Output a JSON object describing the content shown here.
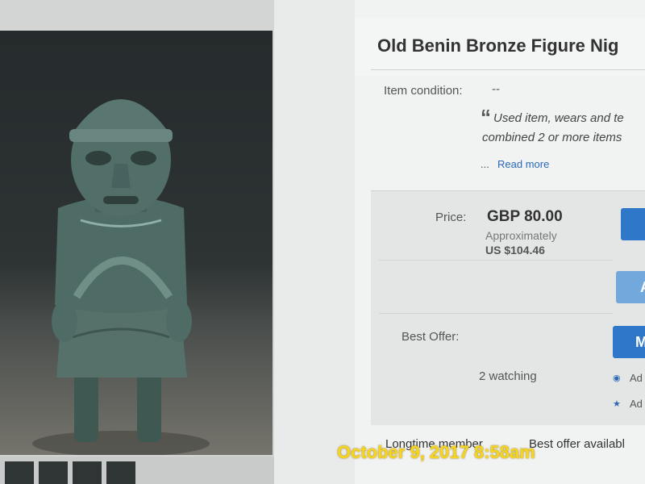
{
  "listing": {
    "title": "Old Benin Bronze Figure Nig",
    "condition_label": "Item condition:",
    "condition_value": "--",
    "description_line1": "Used item, wears and te",
    "description_line2": "combined 2 or more items",
    "ellipsis": "...",
    "read_more": "Read more"
  },
  "pricing": {
    "price_label": "Price:",
    "price": "GBP 80.00",
    "approx_label": "Approximately",
    "usd_price": "US $104.46",
    "buy_button_label": "",
    "add_button_label": "A",
    "best_offer_label": "Best Offer:",
    "offer_button_label": "M",
    "watching": "2 watching",
    "watch_link": "Ad",
    "collection_link": "Ad"
  },
  "footer": {
    "seller_note": "Longtime member",
    "best_offer_note": "Best offer availabl"
  },
  "overlay": {
    "timestamp": "October 9, 2017 8:58am"
  },
  "colors": {
    "accent": "#2f77c8",
    "link": "#2a6ab8",
    "timestamp": "#f7d51c"
  },
  "icons": {
    "watch": "eye-icon",
    "collection": "star-icon"
  }
}
